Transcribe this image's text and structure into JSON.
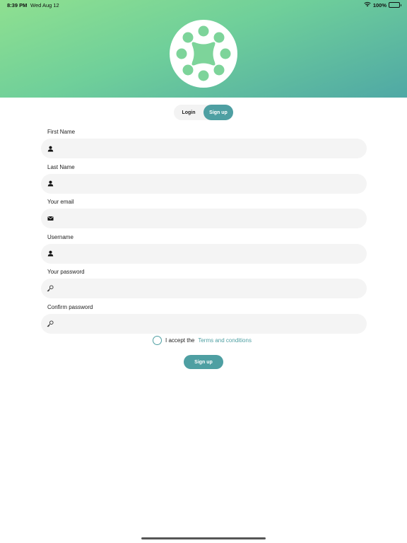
{
  "status_bar": {
    "time": "8:39 PM",
    "date": "Wed Aug 12",
    "battery": "100%",
    "icons": [
      "wifi-icon",
      "battery-icon"
    ]
  },
  "colors": {
    "header_gradient": [
      "#8fe090",
      "#6fcf9a",
      "#4fa8a5"
    ],
    "accent": "#4e9fa2",
    "logo_dots": "#7dd49a",
    "field_background": "#f4f4f4"
  },
  "logo": {
    "icon": "app-logo-icon"
  },
  "segmented": {
    "login_label": "Login",
    "signup_label": "Sign up",
    "selected": "Sign up"
  },
  "fields": {
    "first_name": {
      "label": "First Name",
      "value": "",
      "icon": "person-icon"
    },
    "last_name": {
      "label": "Last Name",
      "value": "",
      "icon": "person-icon"
    },
    "email": {
      "label": "Your email",
      "value": "",
      "icon": "envelope-icon"
    },
    "username": {
      "label": "Username",
      "value": "",
      "icon": "person-icon"
    },
    "password": {
      "label": "Your password",
      "value": "",
      "icon": "key-icon"
    },
    "confirm_password": {
      "label": "Confirm password",
      "value": "",
      "icon": "key-icon"
    }
  },
  "accept": {
    "text": "I accept the",
    "link": "Terms and conditions",
    "checked": false
  },
  "submit_label": "Sign up"
}
